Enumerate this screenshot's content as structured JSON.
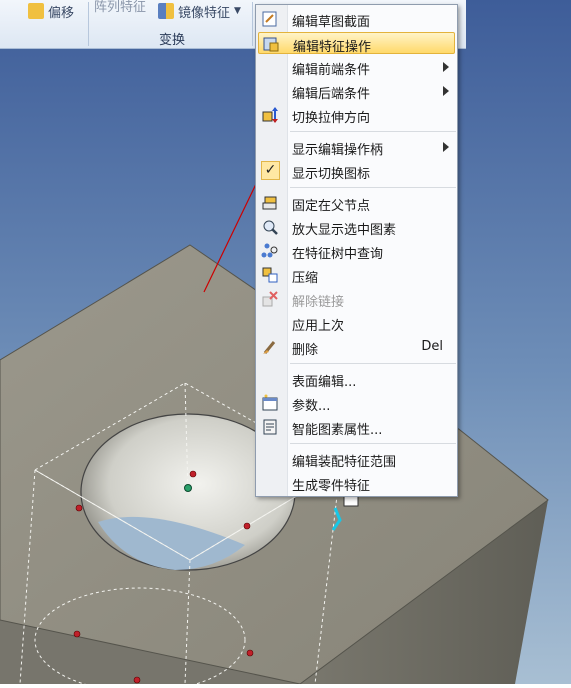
{
  "ribbon": {
    "move_label": "偏移",
    "array_label": "阵列特征",
    "mirror_label": "镜像特征",
    "group_label": "变换"
  },
  "menu": {
    "items": [
      {
        "label": "编辑草图截面",
        "icon": "sketch-edit-icon"
      },
      {
        "label": "编辑特征操作",
        "icon": "feature-edit-icon",
        "highlighted": true
      },
      {
        "label": "编辑前端条件",
        "submenu": true
      },
      {
        "label": "编辑后端条件",
        "submenu": true
      },
      {
        "label": "切换拉伸方向",
        "icon": "flip-direction-icon"
      },
      {
        "label": "显示编辑操作柄",
        "submenu": true
      },
      {
        "label": "显示切换图标",
        "checked": true
      },
      {
        "label": "固定在父节点",
        "icon": "pin-parent-icon"
      },
      {
        "label": "放大显示选中图素",
        "icon": "zoom-selection-icon"
      },
      {
        "label": "在特征树中查询",
        "icon": "tree-search-icon"
      },
      {
        "label": "压缩",
        "icon": "suppress-icon"
      },
      {
        "label": "解除链接",
        "icon": "unlink-icon",
        "disabled": true
      },
      {
        "label": "应用上次"
      },
      {
        "label": "删除",
        "icon": "delete-brush-icon",
        "shortcut": "Del"
      },
      {
        "label": "表面编辑..."
      },
      {
        "label": "参数...",
        "icon": "parameters-icon"
      },
      {
        "label": "智能图素属性...",
        "icon": "properties-icon"
      },
      {
        "label": "编辑装配特征范围"
      },
      {
        "label": "生成零件特征"
      }
    ]
  },
  "colors": {
    "background_top": "#3f5f9a",
    "background_bottom": "#9fb6cc",
    "part_face": "#8f8c80",
    "part_side": "#6b6a62",
    "highlight": "#ffd96b",
    "arrow": "#cc0000"
  }
}
